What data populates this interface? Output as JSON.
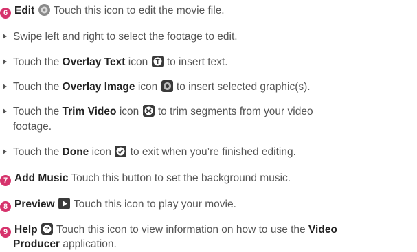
{
  "items": [
    {
      "num": "6",
      "title": "Edit",
      "icon": "film-edit-icon",
      "text": "Touch this icon to edit the movie file."
    },
    {
      "lead": "Swipe left and right to select the footage to edit."
    },
    {
      "lead": "Touch the",
      "title": "Overlay Text",
      "mid": "icon",
      "icon": "text-t-icon",
      "text": "to insert text."
    },
    {
      "lead": "Touch the",
      "title": "Overlay Image",
      "mid": "icon",
      "icon": "image-overlay-icon",
      "text": "to insert selected graphic(s)."
    },
    {
      "lead": "Touch the",
      "title": "Trim Video",
      "mid": "icon",
      "icon": "trim-scissors-icon",
      "text": "to trim segments from your video",
      "cont": "footage."
    },
    {
      "lead": "Touch the",
      "title": "Done",
      "mid": "icon",
      "icon": "checkmark-icon",
      "text": "to exit when you’re finished editing."
    },
    {
      "num": "7",
      "title": "Add Music",
      "text": "Touch this button to set the background music."
    },
    {
      "num": "8",
      "title": "Preview",
      "icon": "play-icon",
      "text": "Touch this icon to play your movie."
    },
    {
      "num": "9",
      "title": "Help",
      "icon": "help-question-icon",
      "text": "Touch this icon to view information on how to use the",
      "title2": "Video",
      "cont_title": "Producer",
      "cont": "application."
    }
  ],
  "colors": {
    "accent": "#d6336c",
    "text": "#555555",
    "bold": "#222222",
    "icon_bg": "#3a3a3a"
  }
}
